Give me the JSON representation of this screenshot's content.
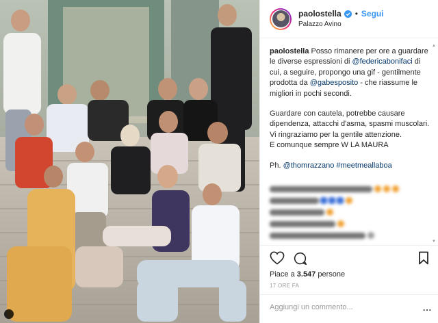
{
  "post": {
    "username": "paolostella",
    "follow_label": "Segui",
    "location": "Palazzo Avino",
    "colors": {
      "link": "#003569",
      "follow": "#3897f0",
      "verified": "#3897f0"
    }
  },
  "caption": {
    "author": "paolostella",
    "t1": "Posso rimanere per ore a guardare le diverse espressioni di",
    "mention1": "@federicabonifaci",
    "t2": "di cui, a seguire, propongo una gif - gentilmente prodotta da",
    "mention2": "@gabesposito",
    "t3": "- che riassume le migliori in pochi secondi.",
    "p2": "Guardare con cautela, potrebbe causare dipendenza, attacchi d'asma, spasmi muscolari.",
    "p3": "Vi ringraziamo per la gentile attenzione.",
    "p4": "E comunque sempre W LA MAURA",
    "ph_prefix": "Ph.",
    "mention3": "@thomrazzano",
    "hashtag": "#meetmeallaboa"
  },
  "footer": {
    "likes_prefix": "Piace a",
    "likes_count": "3.547",
    "likes_suffix": "persone",
    "time": "17 ORE FA",
    "comment_placeholder": "Aggiungi un commento...",
    "more": "..."
  },
  "icons": [
    "verified-icon",
    "heart-icon",
    "comment-icon",
    "bookmark-icon",
    "more-icon"
  ]
}
